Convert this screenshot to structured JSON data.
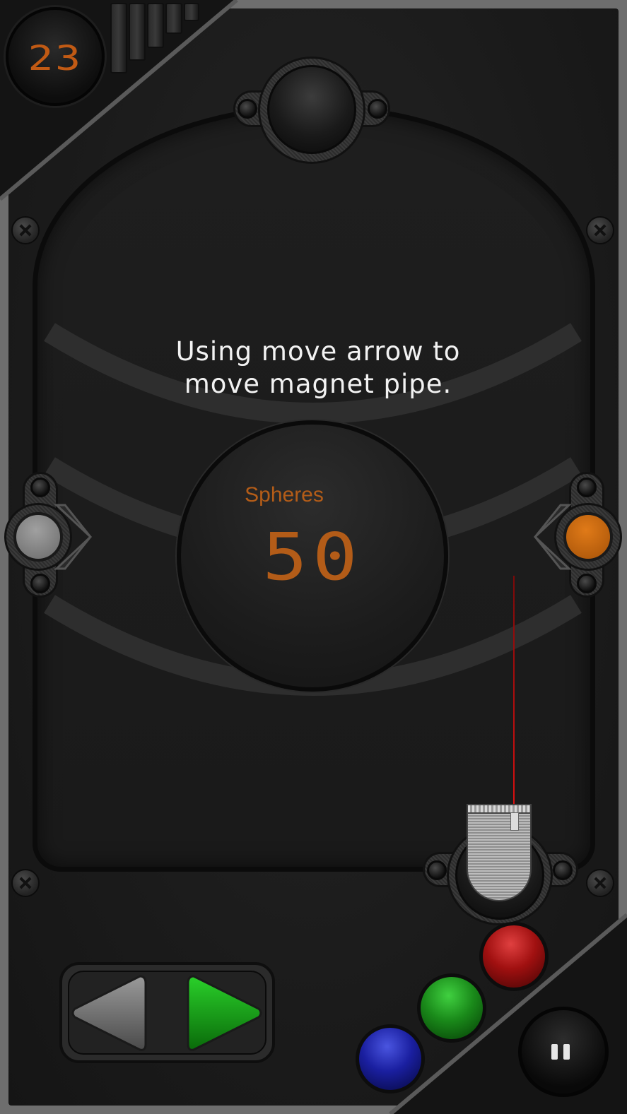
{
  "score": {
    "value": "23"
  },
  "hint": {
    "line1": "Using move arrow to",
    "line2": "move magnet pipe."
  },
  "spheres": {
    "label": "Spheres",
    "count": "50"
  },
  "colors": {
    "accent_orange": "#b35c18",
    "left_ball": "#8a8a8a",
    "right_ball": "#c2680c",
    "orb_red": "#b01818",
    "orb_green": "#1f8f1f",
    "orb_blue": "#1a1fa0",
    "arrow_right": "#1aa01a",
    "laser": "#e01010"
  },
  "icons": {
    "left_arrow": "left-arrow-icon",
    "right_arrow": "right-arrow-icon",
    "pause": "pause-icon"
  }
}
